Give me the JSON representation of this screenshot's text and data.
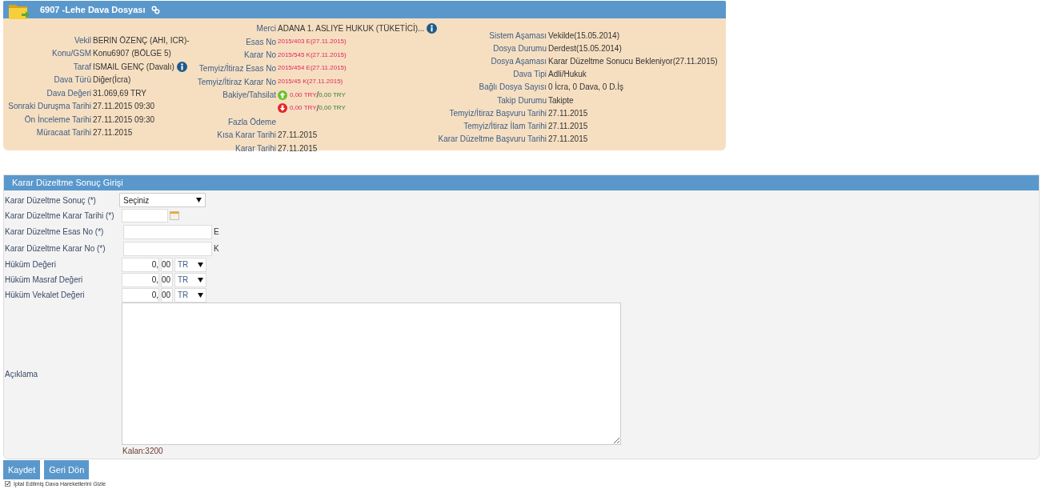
{
  "header": {
    "number": "6907",
    "title": "-Lehe Dava Dosyası"
  },
  "details": {
    "columns": [
      {
        "rows": [
          {
            "label": "Vekil",
            "value": "BERIN ÖZENÇ (AHI, ICR)-",
            "kind": "text"
          },
          {
            "label": "Konu/GSM",
            "value": "Konu6907 (BÖLGE 5)",
            "kind": "text"
          },
          {
            "label": "Taraf",
            "value": "ISMAIL GENÇ (Davalı)",
            "kind": "text",
            "info": true
          },
          {
            "label": "Dava Türü",
            "value": "Diğer(İcra)",
            "kind": "text"
          },
          {
            "label": "Dava Değeri",
            "value": "31.069,69 TRY",
            "kind": "text"
          },
          {
            "label": "Sonraki Duruşma Tarihi",
            "value": "27.11.2015 09:30",
            "kind": "text"
          },
          {
            "label": "Ön İnceleme Tarihi",
            "value": "27.11.2015 09:30",
            "kind": "text"
          },
          {
            "label": "Müracaat Tarihi",
            "value": "27.11.2015",
            "kind": "text"
          }
        ]
      },
      {
        "rows": [
          {
            "label": "Merci",
            "value": "ADANA 1. ASLIYE HUKUK (TÜKETİCİ)...",
            "kind": "text",
            "info": true
          },
          {
            "label": "Esas No",
            "value": "2015/403 E(27.11.2015)",
            "kind": "code"
          },
          {
            "label": "Karar No",
            "value": "2015/545 K(27.11.2015)",
            "kind": "code"
          },
          {
            "label": "Temyiz/İtiraz Esas No",
            "value": "2015/454 E(27.11.2015)",
            "kind": "code"
          },
          {
            "label": "Temyiz/İtiraz Karar No",
            "value": "2015/45 K(27.11.2015)",
            "kind": "code"
          },
          {
            "label": "Bakiye/Tahsilat",
            "kind": "balance_up",
            "debt": "0,00 TRY",
            "separator": "/",
            "paid": "0,00 TRY"
          },
          {
            "kind": "balance_down",
            "debt": "0,00 TRY",
            "separator": "/",
            "paid": "0,00 TRY"
          },
          {
            "label": "Fazla Ödeme",
            "kind": "text"
          },
          {
            "label": "Kısa Karar Tarihi",
            "value": "27.11.2015",
            "kind": "text"
          },
          {
            "label": "Karar Tarihi",
            "value": "27.11.2015",
            "kind": "text"
          }
        ]
      },
      {
        "rows": [
          {
            "label": "Sistem Aşaması",
            "value": "Vekilde(15.05.2014)",
            "kind": "text"
          },
          {
            "label": "Dosya Durumu",
            "value": "Derdest(15.05.2014)",
            "kind": "text"
          },
          {
            "label": "Dosya Aşaması",
            "value": "Karar Düzeltme Sonucu Bekleniyor(27.11.2015)",
            "kind": "text"
          },
          {
            "label": "Dava Tipi",
            "value": "Adli/Hukuk",
            "kind": "text"
          },
          {
            "label": "Bağlı Dosya Sayısı",
            "value": "0 İcra, 0 Dava, 0 D.İş",
            "kind": "text"
          },
          {
            "label": "Takip Durumu",
            "value": "Takipte",
            "kind": "text"
          },
          {
            "label": "Temyiz/İtiraz Başvuru Tarihi",
            "value": "27.11.2015",
            "kind": "text"
          },
          {
            "label": "Temyiz/İtiraz İlam Tarihi",
            "value": "27.11.2015",
            "kind": "text"
          },
          {
            "label": "Karar Düzeltme Başvuru Tarihi",
            "value": "27.11.2015",
            "kind": "text"
          }
        ]
      }
    ]
  },
  "form": {
    "title": "Karar Düzeltme Sonuç Girişi",
    "fields": [
      {
        "kind": "select",
        "label": "Karar Düzeltme Sonuç (*)",
        "value": "Seçiniz"
      },
      {
        "kind": "date",
        "label": "Karar Düzeltme Karar Tarihi (*)"
      },
      {
        "kind": "text",
        "label": "Karar Düzeltme Esas No (*)",
        "suffix": "E"
      },
      {
        "kind": "text",
        "label": "Karar Düzeltme Karar No (*)",
        "suffix": "K"
      },
      {
        "kind": "money",
        "label": "Hüküm Değeri",
        "integer": "0",
        "separator": ",",
        "decimals": "00",
        "currency": "TR"
      },
      {
        "kind": "money",
        "label": "Hüküm Masraf Değeri",
        "integer": "0",
        "separator": ",",
        "decimals": "00",
        "currency": "TR"
      },
      {
        "kind": "money",
        "label": "Hüküm Vekalet Değeri",
        "integer": "0",
        "separator": ",",
        "decimals": "00",
        "currency": "TR"
      },
      {
        "kind": "textarea",
        "label": "Açıklama",
        "counter": "Kalan:3200"
      }
    ]
  },
  "buttons": [
    "Kaydet",
    "Geri Dön"
  ],
  "footer_checkbox": {
    "label": "İptal Edilmiş Dava Hareketlerini Gizle",
    "checked": true
  }
}
